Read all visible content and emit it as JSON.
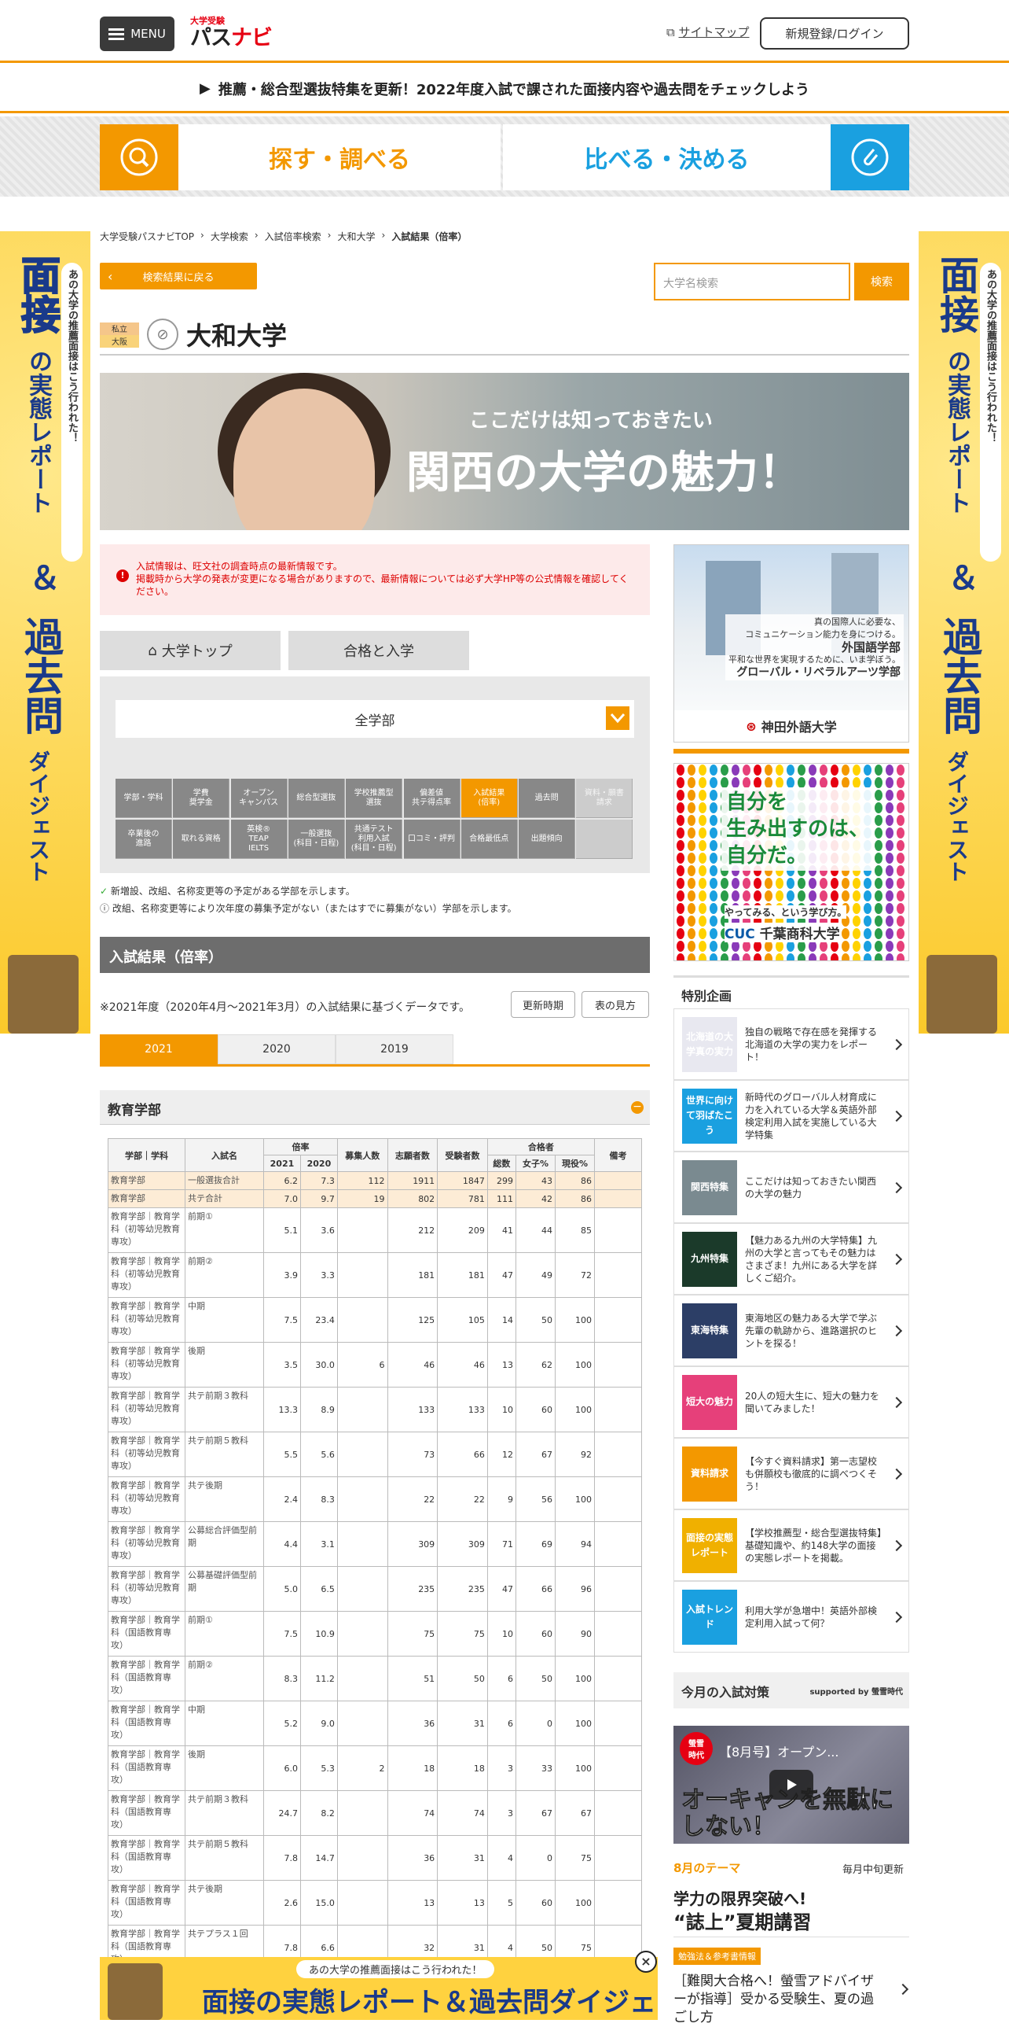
{
  "header": {
    "menu_label": "MENU",
    "logo_small": "大学受験",
    "logo_main_1": "パス",
    "logo_main_2": "ナビ",
    "sitemap_label": "サイトマップ",
    "login_label": "新規登録/ログイン"
  },
  "notice": "推薦・総合型選抜特集を更新！2022年度入試で課された面接内容や過去問をチェックしよう",
  "main_tabs": {
    "search": "探す・調べる",
    "compare": "比べる・決める"
  },
  "side_banner": {
    "sub": "あの大学の推薦面接はこう行われた！",
    "line1": "面接",
    "line2": "の実態レポート",
    "line3": "＆",
    "line4": "過去問",
    "line5": "ダイジェスト"
  },
  "breadcrumb": [
    "大学受験パスナビTOP",
    "大学検索",
    "入試倍率検索",
    "大和大学",
    "入試結果（倍率）"
  ],
  "back_label": "検索結果に戻る",
  "uni_search": {
    "placeholder": "大学名検索",
    "button": "検索"
  },
  "university": {
    "type": "私立",
    "region": "大阪",
    "name": "大和大学"
  },
  "kansai_banner": {
    "sub": "ここだけは知っておきたい",
    "title": "関西の大学の魅力！"
  },
  "alert": {
    "line1": "入試情報は、旺文社の調査時点の最新情報です。",
    "line2": "掲載時から大学の発表が変更になる場合がありますので、最新情報については必ず大学HP等の公式情報を確認してください。"
  },
  "nav_buttons": {
    "top": "大学トップ",
    "admission": "合格と入学"
  },
  "faculty_select": "全学部",
  "grid_nav": [
    [
      "学部・学科",
      "学費\n奨学金",
      "オープン\nキャンパス",
      "総合型選抜",
      "学校推薦型\n選抜",
      "偏差値\n共テ得点率",
      "入試結果\n(倍率)",
      "過去問",
      "資料・願書\n請求"
    ],
    [
      "卒業後の\n進路",
      "取れる資格",
      "英検®\nTEAP\nIELTS",
      "一般選抜\n(科目・日程)",
      "共通テスト\n利用入試\n(科目・日程)",
      "口コミ・評判",
      "合格最低点",
      "出題傾向",
      ""
    ]
  ],
  "legend": {
    "new": "新増設、改組、名称変更等の予定がある学部を示します。",
    "stop": "改組、名称変更等により次年度の募集予定がない（またはすでに募集がない）学部を示します。"
  },
  "results": {
    "title": "入試結果（倍率）",
    "note": "※2021年度（2020年4月～2021年3月）の入試結果に基づくデータです。",
    "update_btn": "更新時期",
    "howto_btn": "表の見方",
    "years": [
      "2021",
      "2020",
      "2019"
    ],
    "dept": "教育学部"
  },
  "table": {
    "headers": {
      "dept": "学部｜学科",
      "exam": "入試名",
      "ratio": "倍率",
      "y2021": "2021",
      "y2020": "2020",
      "quota": "募集人数",
      "applicants": "志願者数",
      "examinees": "受験者数",
      "passers": "合格者",
      "total": "総数",
      "women": "女子%",
      "current": "現役%",
      "remarks": "備考"
    },
    "rows": [
      {
        "dept": "教育学部",
        "exam": "一般選抜合計",
        "r21": "6.2",
        "r20": "7.3",
        "quota": "112",
        "app": "1911",
        "exm": "1847",
        "tot": "299",
        "wom": "43",
        "cur": "86",
        "hi": true
      },
      {
        "dept": "教育学部",
        "exam": "共テ合計",
        "r21": "7.0",
        "r20": "9.7",
        "quota": "19",
        "app": "802",
        "exm": "781",
        "tot": "111",
        "wom": "42",
        "cur": "86",
        "hi": true
      },
      {
        "dept": "教育学部｜教育学科（初等幼児教育専攻）",
        "exam": "前期①",
        "r21": "5.1",
        "r20": "3.6",
        "quota": "",
        "app": "212",
        "exm": "209",
        "tot": "41",
        "wom": "44",
        "cur": "85"
      },
      {
        "dept": "教育学部｜教育学科（初等幼児教育専攻）",
        "exam": "前期②",
        "r21": "3.9",
        "r20": "3.3",
        "quota": "",
        "app": "181",
        "exm": "181",
        "tot": "47",
        "wom": "49",
        "cur": "72"
      },
      {
        "dept": "教育学部｜教育学科（初等幼児教育専攻）",
        "exam": "中期",
        "r21": "7.5",
        "r20": "23.4",
        "quota": "",
        "app": "125",
        "exm": "105",
        "tot": "14",
        "wom": "50",
        "cur": "100"
      },
      {
        "dept": "教育学部｜教育学科（初等幼児教育専攻）",
        "exam": "後期",
        "r21": "3.5",
        "r20": "30.0",
        "quota": "6",
        "app": "46",
        "exm": "46",
        "tot": "13",
        "wom": "62",
        "cur": "100"
      },
      {
        "dept": "教育学部｜教育学科（初等幼児教育専攻）",
        "exam": "共テ前期３教科",
        "r21": "13.3",
        "r20": "8.9",
        "quota": "",
        "app": "133",
        "exm": "133",
        "tot": "10",
        "wom": "60",
        "cur": "100"
      },
      {
        "dept": "教育学部｜教育学科（初等幼児教育専攻）",
        "exam": "共テ前期５教科",
        "r21": "5.5",
        "r20": "5.6",
        "quota": "",
        "app": "73",
        "exm": "66",
        "tot": "12",
        "wom": "67",
        "cur": "92"
      },
      {
        "dept": "教育学部｜教育学科（初等幼児教育専攻）",
        "exam": "共テ後期",
        "r21": "2.4",
        "r20": "8.3",
        "quota": "",
        "app": "22",
        "exm": "22",
        "tot": "9",
        "wom": "56",
        "cur": "100"
      },
      {
        "dept": "教育学部｜教育学科（初等幼児教育専攻）",
        "exam": "公募総合評価型前期",
        "r21": "4.4",
        "r20": "3.1",
        "quota": "",
        "app": "309",
        "exm": "309",
        "tot": "71",
        "wom": "69",
        "cur": "94"
      },
      {
        "dept": "教育学部｜教育学科（初等幼児教育専攻）",
        "exam": "公募基礎評価型前期",
        "r21": "5.0",
        "r20": "6.5",
        "quota": "",
        "app": "235",
        "exm": "235",
        "tot": "47",
        "wom": "66",
        "cur": "96"
      },
      {
        "dept": "教育学部｜教育学科（国語教育専攻）",
        "exam": "前期①",
        "r21": "7.5",
        "r20": "10.9",
        "quota": "",
        "app": "75",
        "exm": "75",
        "tot": "10",
        "wom": "60",
        "cur": "90"
      },
      {
        "dept": "教育学部｜教育学科（国語教育専攻）",
        "exam": "前期②",
        "r21": "8.3",
        "r20": "11.2",
        "quota": "",
        "app": "51",
        "exm": "50",
        "tot": "6",
        "wom": "50",
        "cur": "100"
      },
      {
        "dept": "教育学部｜教育学科（国語教育専攻）",
        "exam": "中期",
        "r21": "5.2",
        "r20": "9.0",
        "quota": "",
        "app": "36",
        "exm": "31",
        "tot": "6",
        "wom": "0",
        "cur": "100"
      },
      {
        "dept": "教育学部｜教育学科（国語教育専攻）",
        "exam": "後期",
        "r21": "6.0",
        "r20": "5.3",
        "quota": "2",
        "app": "18",
        "exm": "18",
        "tot": "3",
        "wom": "33",
        "cur": "100"
      },
      {
        "dept": "教育学部｜教育学科（国語教育専攻）",
        "exam": "共テ前期３教科",
        "r21": "24.7",
        "r20": "8.2",
        "quota": "",
        "app": "74",
        "exm": "74",
        "tot": "3",
        "wom": "67",
        "cur": "67"
      },
      {
        "dept": "教育学部｜教育学科（国語教育専攻）",
        "exam": "共テ前期５教科",
        "r21": "7.8",
        "r20": "14.7",
        "quota": "",
        "app": "36",
        "exm": "31",
        "tot": "4",
        "wom": "0",
        "cur": "75"
      },
      {
        "dept": "教育学部｜教育学科（国語教育専攻）",
        "exam": "共テ後期",
        "r21": "2.6",
        "r20": "15.0",
        "quota": "",
        "app": "13",
        "exm": "13",
        "tot": "5",
        "wom": "60",
        "cur": "100"
      },
      {
        "dept": "教育学部｜教育学科（国語教育専攻）",
        "exam": "共テプラス１回",
        "r21": "7.8",
        "r20": "6.6",
        "quota": "",
        "app": "32",
        "exm": "31",
        "tot": "4",
        "wom": "50",
        "cur": "75"
      }
    ]
  },
  "kanda_ad": {
    "line1": "真の国際人に必要な、",
    "line2": "コミュニケーション能力を身につける。",
    "faculty1": "外国語学部",
    "line3": "平和な世界を実現するために、いま学ぼう。",
    "faculty2": "グローバル・リベラルアーツ学部",
    "name": "神田外語大学"
  },
  "chiba_ad": {
    "line1": "自分を",
    "line2": "生み出すのは、",
    "line3": "自分だ。",
    "tag": "やってみる、という学び方。",
    "name": "千葉商科大学"
  },
  "special": {
    "title": "特別企画",
    "items": [
      {
        "thumb": "北海道の大学真の実力",
        "text": "独自の戦略で存在感を発揮する北海道の大学の実力をレポート！",
        "color": "#e8e8f0"
      },
      {
        "thumb": "世界に向けて羽ばたこう",
        "text": "新時代のグローバル人材育成に力を入れている大学＆英語外部検定利用入試を実施している大学特集",
        "color": "#1aa0e0"
      },
      {
        "thumb": "関西特集",
        "text": "ここだけは知っておきたい関西の大学の魅力",
        "color": "#7a8a90"
      },
      {
        "thumb": "九州特集",
        "text": "【魅力ある九州の大学特集】九州の大学と言ってもその魅力はさまざま！九州にある大学を詳しくご紹介。",
        "color": "#1b3a2a"
      },
      {
        "thumb": "東海特集",
        "text": "東海地区の魅力ある大学で学ぶ先輩の軌跡から、進路選択のヒントを探る！",
        "color": "#2c3e66"
      },
      {
        "thumb": "短大の魅力",
        "text": "20人の短大生に、短大の魅力を聞いてみました！",
        "color": "#e6407a"
      },
      {
        "thumb": "資料請求",
        "text": "【今すぐ資料請求】第一志望校も併願校も徹底的に調べつくそう！",
        "color": "#f39800"
      },
      {
        "thumb": "面接の実態レポート",
        "text": "【学校推薦型・総合型選抜特集】基礎知識や、約148大学の面接の実態レポートを掲載。",
        "color": "#f0b000"
      },
      {
        "thumb": "入試トレンド",
        "text": "利用大学が急増中！英語外部検定利用入試って何？",
        "color": "#1aa0e0"
      }
    ]
  },
  "monthly": {
    "title": "今月の入試対策",
    "supported": "supported by 螢雪時代",
    "video_title": "【8月号】オープン...",
    "video_caption": "オーキャンを無駄にしない！",
    "theme_label": "8月のテーマ",
    "update": "毎月中旬更新",
    "theme_title_1": "学力の限界突破へ!",
    "theme_title_2": "“誌上”夏期講習",
    "tag": "勉強法＆参考書情報",
    "article": "［難関大合格へ！螢雪アドバイザーが指導］受かる受験生、夏の過ごし方"
  },
  "bottom_banner": {
    "sub": "あの大学の推薦面接はこう行われた！",
    "main": "面接の実態レポート＆過去問ダイジェスト"
  },
  "colors": {
    "accent": "#f39800",
    "blue": "#1aa0e0",
    "alert": "#dd0000"
  }
}
